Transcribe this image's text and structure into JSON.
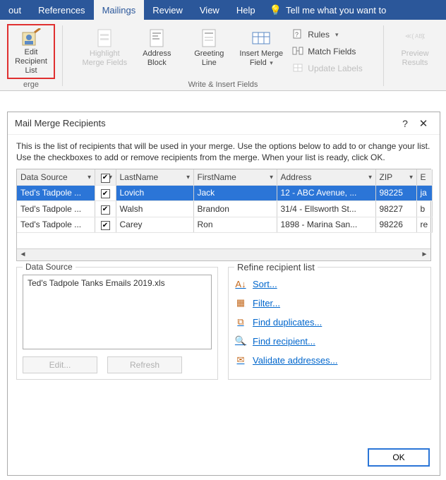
{
  "tabs": {
    "layout": "out",
    "references": "References",
    "mailings": "Mailings",
    "review": "Review",
    "view": "View",
    "help": "Help",
    "tellme": "Tell me what you want to"
  },
  "ribbon": {
    "edit_recipient": "Edit\nRecipient List",
    "highlight": "Highlight\nMerge Fields",
    "address": "Address\nBlock",
    "greeting": "Greeting\nLine",
    "insert_mf": "Insert Merge\nField",
    "rules": "Rules",
    "match": "Match Fields",
    "update_labels": "Update Labels",
    "preview": "Preview\nResults",
    "group1": "erge",
    "group2": "Write & Insert Fields"
  },
  "dialog": {
    "title": "Mail Merge Recipients",
    "instructions": "This is the list of recipients that will be used in your merge.  Use the options below to add to or change your list.  Use the checkboxes to add or remove recipients from the merge.  When your list is ready, click OK.",
    "headers": {
      "ds": "Data Source",
      "last": "LastName",
      "first": "FirstName",
      "addr": "Address",
      "zip": "ZIP",
      "e": "E"
    },
    "rows": [
      {
        "ds": "Ted's Tadpole ...",
        "last": "Lovich",
        "first": "Jack",
        "addr": "12 - ABC Avenue, ...",
        "zip": "98225",
        "e": "ja"
      },
      {
        "ds": "Ted's Tadpole ...",
        "last": "Walsh",
        "first": "Brandon",
        "addr": "31/4 - Ellsworth St...",
        "zip": "98227",
        "e": "b"
      },
      {
        "ds": "Ted's Tadpole ...",
        "last": "Carey",
        "first": "Ron",
        "addr": "1898 - Marina San...",
        "zip": "98226",
        "e": "re"
      }
    ],
    "ds_label": "Data Source",
    "ds_file": "Ted's Tadpole Tanks Emails 2019.xls",
    "edit": "Edit...",
    "refresh": "Refresh",
    "refine_label": "Refine recipient list",
    "sort": "Sort...",
    "filter": "Filter...",
    "dupes": "Find duplicates...",
    "find": "Find recipient...",
    "validate": "Validate addresses...",
    "ok": "OK"
  }
}
